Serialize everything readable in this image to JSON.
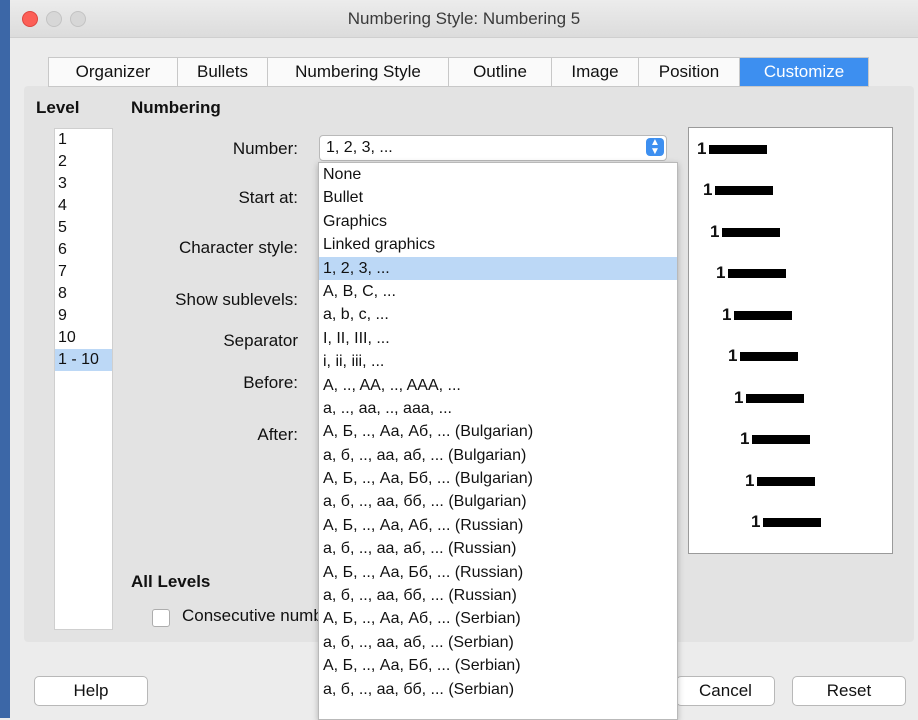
{
  "window": {
    "title": "Numbering Style: Numbering 5"
  },
  "tabs": [
    {
      "label": "Organizer"
    },
    {
      "label": "Bullets"
    },
    {
      "label": "Numbering Style"
    },
    {
      "label": "Outline"
    },
    {
      "label": "Image"
    },
    {
      "label": "Position"
    },
    {
      "label": "Customize",
      "active": true
    }
  ],
  "level": {
    "heading": "Level",
    "items": [
      "1",
      "2",
      "3",
      "4",
      "5",
      "6",
      "7",
      "8",
      "9",
      "10",
      "1 - 10"
    ],
    "selected": "1 - 10"
  },
  "numbering": {
    "heading": "Numbering",
    "labels": {
      "number": "Number:",
      "start_at": "Start at:",
      "character_style": "Character style:",
      "show_sublevels": "Show sublevels:",
      "separator": "Separator",
      "before": "Before:",
      "after": "After:"
    },
    "number_value": "1, 2, 3, ...",
    "options": [
      "None",
      "Bullet",
      "Graphics",
      "Linked graphics",
      "1, 2, 3, ...",
      "A, B, C, ...",
      "a, b, c, ...",
      "I, II, III, ...",
      "i, ii, iii, ...",
      "A, .., AA, .., AAA, ...",
      "a, .., aa, .., aaa, ...",
      "А, Б, .., Аа, Аб, ... (Bulgarian)",
      "а, б, .., аа, аб, ... (Bulgarian)",
      "А, Б, .., Аа, Бб, ... (Bulgarian)",
      "а, б, .., аа, бб, ... (Bulgarian)",
      "А, Б, .., Аа, Аб, ... (Russian)",
      "а, б, .., аа, аб, ... (Russian)",
      "А, Б, .., Аа, Бб, ... (Russian)",
      "а, б, .., аа, бб, ... (Russian)",
      "А, Б, .., Аа, Аб, ... (Serbian)",
      "а, б, .., аа, аб, ... (Serbian)",
      "А, Б, .., Аа, Бб, ... (Serbian)",
      "а, б, .., аа, бб, ... (Serbian)"
    ],
    "selected_option": "1, 2, 3, ..."
  },
  "preview": {
    "number_label": "1",
    "row_count": 10
  },
  "all_levels": {
    "heading": "All Levels",
    "consecutive_label": "Consecutive numbering",
    "consecutive_checked": false
  },
  "buttons": {
    "help": "Help",
    "cancel": "Cancel",
    "reset": "Reset"
  }
}
